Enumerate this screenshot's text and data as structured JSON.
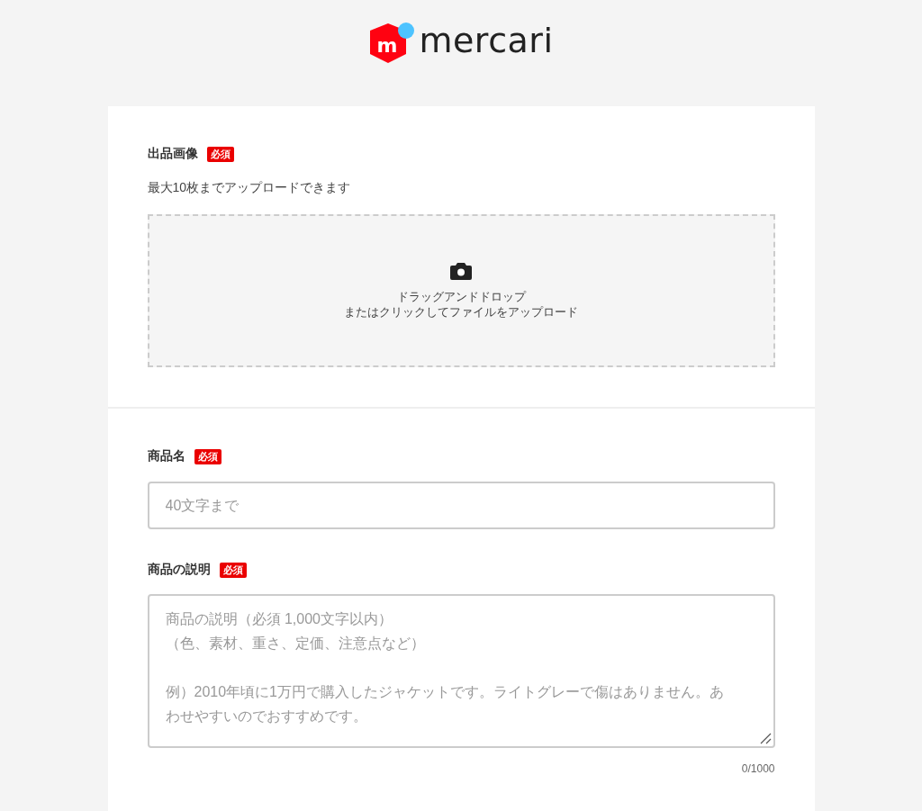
{
  "logo": {
    "mark": "m",
    "wordmark": "mercari"
  },
  "photo_section": {
    "label": "出品画像",
    "required_badge": "必須",
    "note": "最大10枚までアップロードできます",
    "dropzone": {
      "line_1": "ドラッグアンドドロップ",
      "line_2": "またはクリックしてファイルをアップロード"
    }
  },
  "title_field": {
    "label": "商品名",
    "required_badge": "必須",
    "placeholder": "40文字まで"
  },
  "description_field": {
    "label": "商品の説明",
    "required_badge": "必須",
    "placeholder_lines": [
      "商品の説明（必須 1,000文字以内）",
      "（色、素材、重さ、定価、注意点など）",
      "例）2010年頃に1万円で購入したジャケットです。ライトグレーで傷はありません。あわせやすいのでおすすめです。"
    ],
    "counter": "0/1000"
  }
}
